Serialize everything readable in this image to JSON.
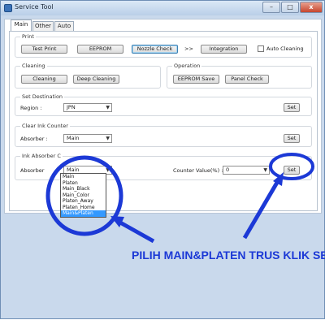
{
  "window": {
    "title": "Service Tool",
    "min_glyph": "–",
    "max_glyph": "□",
    "close_glyph": "x"
  },
  "tabs": [
    "Main",
    "Other",
    "Auto"
  ],
  "print": {
    "label": "Print",
    "test_print": "Test Print",
    "eeprom": "EEPROM",
    "nozzle_check": "Nozzle Check",
    "arrows": ">>",
    "integration": "Integration",
    "auto_cleaning": "Auto Cleaning"
  },
  "cleaning": {
    "label": "Cleaning",
    "cleaning_btn": "Cleaning",
    "deep_cleaning_btn": "Deep Cleaning"
  },
  "operation": {
    "label": "Operation",
    "eeprom_save": "EEPROM Save",
    "panel_check": "Panel Check"
  },
  "set_destination": {
    "label": "Set Destination",
    "region_label": "Region :",
    "region_value": "JPN",
    "set_btn": "Set"
  },
  "clear_ink_counter": {
    "label": "Clear Ink Counter",
    "absorber_label": "Absorber :",
    "absorber_value": "Main",
    "set_btn": "Set"
  },
  "ink_absorber": {
    "label": "Ink Absorber C",
    "absorber_label": "Absorber",
    "absorber_value": "Main",
    "counter_label": "Counter Value(%) :",
    "counter_value": "0",
    "set_btn": "Set"
  },
  "dropdown_options": [
    "Main",
    "Platen",
    "Main_Black",
    "Main_Color",
    "Platen_Away",
    "Platen_Home",
    "Main&Platen"
  ],
  "dropdown_selected_index": 6,
  "instruction_text": "PILIH MAIN&PLATEN TRUS KLIK SET",
  "colors": {
    "annotation_blue": "#1c39d6",
    "selection_blue": "#3399ff",
    "window_frame": "#c9d9ec"
  },
  "icons": [
    "app-icon",
    "dropdown-arrow-icon",
    "annotation-arrow-icon",
    "annotation-circle-icon"
  ]
}
